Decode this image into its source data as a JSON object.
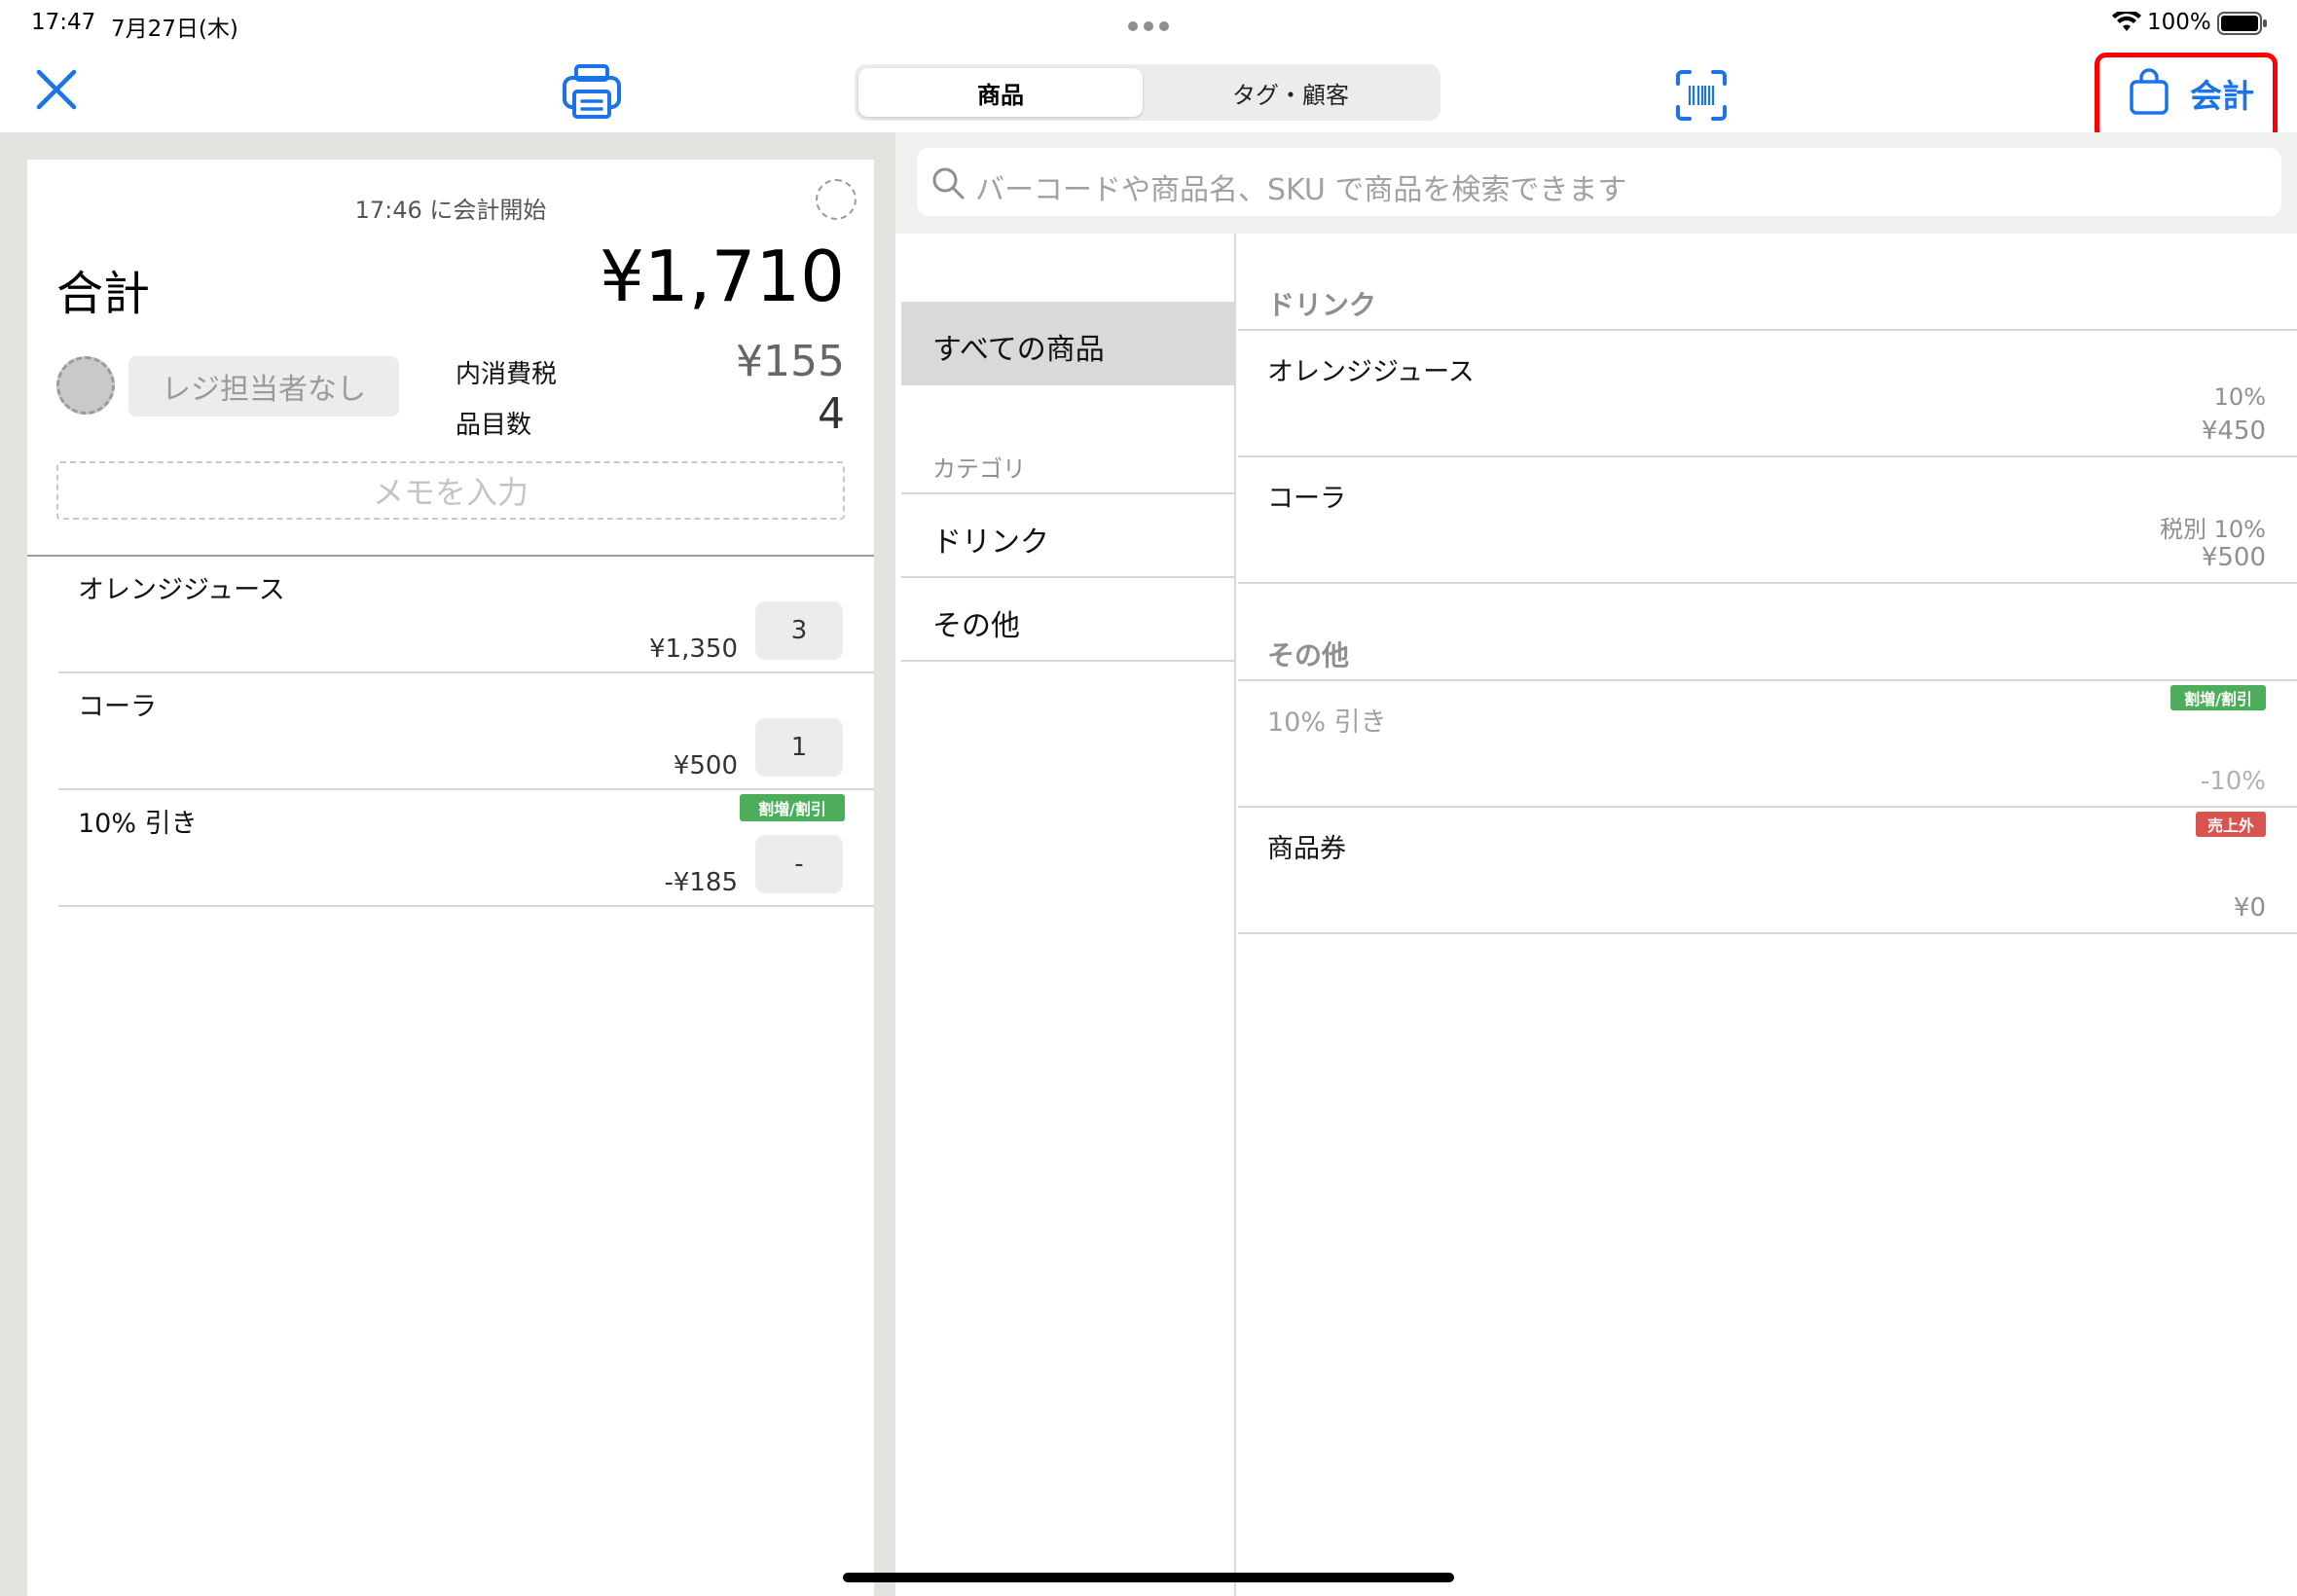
{
  "status_bar": {
    "time": "17:47",
    "date": "7月27日(木)",
    "battery": "100%"
  },
  "toolbar": {
    "segments": [
      "商品",
      "タグ・顧客"
    ],
    "checkout_label": "会計"
  },
  "cart": {
    "started_at": "17:46 に会計開始",
    "total_label": "合計",
    "total_value": "¥1,710",
    "staff_label": "レジ担当者なし",
    "tax_label": "内消費税",
    "tax_value": "¥155",
    "count_label": "品目数",
    "count_value": "4",
    "memo_placeholder": "メモを入力",
    "items": [
      {
        "name": "オレンジジュース",
        "price": "¥1,350",
        "qty": "3",
        "badge": ""
      },
      {
        "name": "コーラ",
        "price": "¥500",
        "qty": "1",
        "badge": ""
      },
      {
        "name": "10% 引き",
        "price": "-¥185",
        "qty": "-",
        "badge": "割増/割引"
      }
    ]
  },
  "search": {
    "placeholder": "バーコードや商品名、SKU で商品を検索できます"
  },
  "categories": {
    "all_label": "すべての商品",
    "section_label": "カテゴリ",
    "items": [
      "ドリンク",
      "その他"
    ]
  },
  "products": {
    "groups": [
      {
        "title": "ドリンク",
        "items": [
          {
            "name": "オレンジジュース",
            "tax": "10%",
            "price": "¥450"
          },
          {
            "name": "コーラ",
            "tax": "税別 10%",
            "price": "¥500"
          }
        ]
      },
      {
        "title": "その他",
        "items": [
          {
            "name": "10% 引き",
            "badge": "割増/割引",
            "price": "-10%"
          },
          {
            "name": "商品券",
            "badge": "売上外",
            "price": "¥0"
          }
        ]
      }
    ]
  },
  "colors": {
    "accent": "#1a73e8",
    "highlight": "#ff0000",
    "badge_green": "#4cae5a",
    "badge_red": "#d9534f"
  }
}
